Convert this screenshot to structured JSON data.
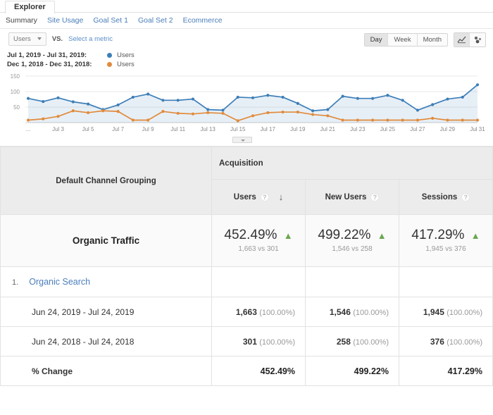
{
  "explorer": {
    "tab_label": "Explorer"
  },
  "subnav": {
    "items": [
      {
        "label": "Summary",
        "active": true
      },
      {
        "label": "Site Usage",
        "active": false
      },
      {
        "label": "Goal Set 1",
        "active": false
      },
      {
        "label": "Goal Set 2",
        "active": false
      },
      {
        "label": "Ecommerce",
        "active": false
      }
    ]
  },
  "metric_row": {
    "primary_metric": "Users",
    "vs_label": "VS.",
    "select_metric_label": "Select a metric"
  },
  "chart_controls": {
    "granularity": [
      {
        "label": "Day",
        "active": true
      },
      {
        "label": "Week",
        "active": false
      },
      {
        "label": "Month",
        "active": false
      }
    ],
    "view_icons": [
      {
        "name": "line-chart-icon",
        "active": true
      },
      {
        "name": "motion-chart-icon",
        "active": false
      }
    ]
  },
  "legend": [
    {
      "range": "Jul 1, 2019 - Jul 31, 2019:",
      "metric": "Users",
      "color": "#3c7eb8"
    },
    {
      "range": "Dec 1, 2018 - Dec 31, 2018:",
      "metric": "Users",
      "color": "#e08b3c"
    }
  ],
  "chart_data": {
    "type": "line",
    "title": "",
    "xlabel": "",
    "ylabel": "",
    "ylim": [
      0,
      150
    ],
    "yticks": [
      50,
      100,
      150
    ],
    "grid": true,
    "legend_position": "top-left",
    "x": [
      "Jul 1",
      "Jul 2",
      "Jul 3",
      "Jul 4",
      "Jul 5",
      "Jul 6",
      "Jul 7",
      "Jul 8",
      "Jul 9",
      "Jul 10",
      "Jul 11",
      "Jul 12",
      "Jul 13",
      "Jul 14",
      "Jul 15",
      "Jul 16",
      "Jul 17",
      "Jul 18",
      "Jul 19",
      "Jul 20",
      "Jul 21",
      "Jul 22",
      "Jul 23",
      "Jul 24",
      "Jul 25",
      "Jul 26",
      "Jul 27",
      "Jul 28",
      "Jul 29",
      "Jul 30",
      "Jul 31"
    ],
    "xtick_labels": [
      "Jul 3",
      "Jul 5",
      "Jul 7",
      "Jul 9",
      "Jul 11",
      "Jul 13",
      "Jul 15",
      "Jul 17",
      "Jul 19",
      "Jul 21",
      "Jul 23",
      "Jul 25",
      "Jul 27",
      "Jul 29",
      "Jul 31"
    ],
    "series": [
      {
        "name": "Jul 1, 2019 - Jul 31, 2019 Users",
        "color": "#3c7eb8",
        "values": [
          78,
          68,
          80,
          67,
          60,
          42,
          57,
          82,
          92,
          72,
          72,
          76,
          42,
          40,
          82,
          80,
          88,
          82,
          62,
          38,
          42,
          85,
          78,
          78,
          88,
          72,
          40,
          58,
          76,
          82,
          122
        ]
      },
      {
        "name": "Dec 1, 2018 - Dec 31, 2018 Users",
        "color": "#e08b3c",
        "values": [
          8,
          12,
          20,
          38,
          32,
          38,
          36,
          8,
          8,
          36,
          30,
          28,
          32,
          30,
          6,
          22,
          32,
          34,
          34,
          26,
          22,
          8,
          8,
          8,
          8,
          8,
          8,
          14,
          8,
          8,
          8
        ]
      }
    ]
  },
  "table": {
    "dimension_header": "Default Channel Grouping",
    "group_header": "Acquisition",
    "metrics": [
      {
        "label": "Users",
        "help": "?",
        "sorted": true,
        "sort_dir": "desc"
      },
      {
        "label": "New Users",
        "help": "?",
        "sorted": false
      },
      {
        "label": "Sessions",
        "help": "?",
        "sorted": false
      }
    ],
    "total_row": {
      "label": "Organic Traffic",
      "cells": [
        {
          "pct": "452.49%",
          "direction": "up",
          "compare": "1,663 vs 301"
        },
        {
          "pct": "499.22%",
          "direction": "up",
          "compare": "1,546 vs 258"
        },
        {
          "pct": "417.29%",
          "direction": "up",
          "compare": "1,945 vs 376"
        }
      ]
    },
    "entry": {
      "index": "1.",
      "label": "Organic Search"
    },
    "detail_rows": [
      {
        "label": "Jun 24, 2019 - Jul 24, 2019",
        "values": [
          {
            "value": "1,663",
            "pct": "(100.00%)"
          },
          {
            "value": "1,546",
            "pct": "(100.00%)"
          },
          {
            "value": "1,945",
            "pct": "(100.00%)"
          }
        ]
      },
      {
        "label": "Jun 24, 2018 - Jul 24, 2018",
        "values": [
          {
            "value": "301",
            "pct": "(100.00%)"
          },
          {
            "value": "258",
            "pct": "(100.00%)"
          },
          {
            "value": "376",
            "pct": "(100.00%)"
          }
        ]
      }
    ],
    "change_row": {
      "label": "% Change",
      "values": [
        "452.49%",
        "499.22%",
        "417.29%"
      ]
    }
  },
  "colors": {
    "series_current": "#3c7eb8",
    "series_previous": "#e08b3c",
    "link": "#4a7ebb",
    "positive": "#6aa84f",
    "header_bg": "#ececec"
  }
}
